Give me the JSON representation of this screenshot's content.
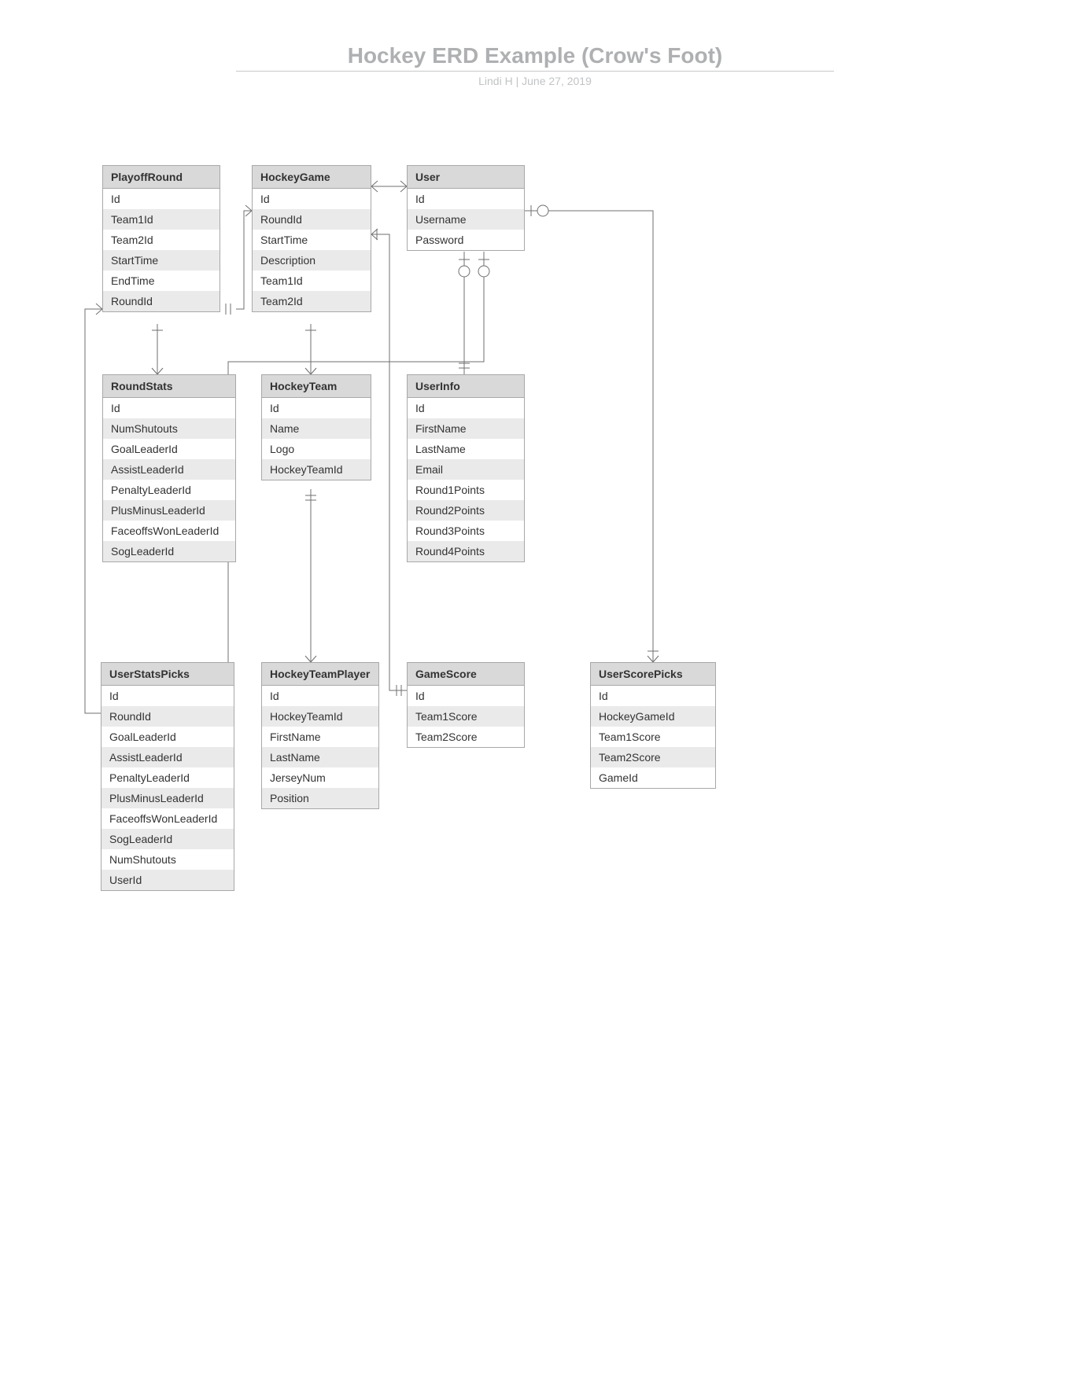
{
  "header": {
    "title": "Hockey ERD Example (Crow's Foot)",
    "subtitle": "Lindi H  |  June 27, 2019"
  },
  "entities": {
    "playoff_round": {
      "name": "PlayoffRound",
      "fields": [
        "Id",
        "Team1Id",
        "Team2Id",
        "StartTime",
        "EndTime",
        "RoundId"
      ]
    },
    "hockey_game": {
      "name": "HockeyGame",
      "fields": [
        "Id",
        "RoundId",
        "StartTime",
        "Description",
        "Team1Id",
        "Team2Id"
      ]
    },
    "user": {
      "name": "User",
      "fields": [
        "Id",
        "Username",
        "Password"
      ]
    },
    "round_stats": {
      "name": "RoundStats",
      "fields": [
        "Id",
        "NumShutouts",
        "GoalLeaderId",
        "AssistLeaderId",
        "PenaltyLeaderId",
        "PlusMinusLeaderId",
        "FaceoffsWonLeaderId",
        "SogLeaderId"
      ]
    },
    "hockey_team": {
      "name": "HockeyTeam",
      "fields": [
        "Id",
        "Name",
        "Logo",
        "HockeyTeamId"
      ]
    },
    "user_info": {
      "name": "UserInfo",
      "fields": [
        "Id",
        "FirstName",
        "LastName",
        "Email",
        "Round1Points",
        "Round2Points",
        "Round3Points",
        "Round4Points"
      ]
    },
    "user_stats_picks": {
      "name": "UserStatsPicks",
      "fields": [
        "Id",
        "RoundId",
        "GoalLeaderId",
        "AssistLeaderId",
        "PenaltyLeaderId",
        "PlusMinusLeaderId",
        "FaceoffsWonLeaderId",
        "SogLeaderId",
        "NumShutouts",
        "UserId"
      ]
    },
    "hockey_team_player": {
      "name": "HockeyTeamPlayer",
      "fields": [
        "Id",
        "HockeyTeamId",
        "FirstName",
        "LastName",
        "JerseyNum",
        "Position"
      ]
    },
    "game_score": {
      "name": "GameScore",
      "fields": [
        "Id",
        "Team1Score",
        "Team2Score"
      ]
    },
    "user_score_picks": {
      "name": "UserScorePicks",
      "fields": [
        "Id",
        "HockeyGameId",
        "Team1Score",
        "Team2Score",
        "GameId"
      ]
    }
  },
  "chart_data": {
    "type": "erd",
    "notation": "crows-foot",
    "relationships": [
      {
        "from": "PlayoffRound",
        "to": "HockeyGame",
        "from_card": "one-mandatory",
        "to_card": "many"
      },
      {
        "from": "PlayoffRound",
        "to": "RoundStats",
        "from_card": "one",
        "to_card": "many"
      },
      {
        "from": "PlayoffRound",
        "to": "UserStatsPicks",
        "from_card": "one",
        "to_card": "many",
        "via": "RoundId"
      },
      {
        "from": "HockeyGame",
        "to": "HockeyTeam",
        "from_card": "one",
        "to_card": "many"
      },
      {
        "from": "HockeyGame",
        "to": "User",
        "from_card": "many",
        "to_card": "many"
      },
      {
        "from": "HockeyGame",
        "to": "GameScore",
        "from_card": "one",
        "to_card": "one-mandatory"
      },
      {
        "from": "HockeyTeam",
        "to": "HockeyTeamPlayer",
        "from_card": "one-mandatory",
        "to_card": "many"
      },
      {
        "from": "User",
        "to": "UserInfo",
        "from_card": "one-optional",
        "to_card": "one-mandatory"
      },
      {
        "from": "User",
        "to": "UserStatsPicks",
        "from_card": "one-optional",
        "to_card": "many"
      },
      {
        "from": "User",
        "to": "UserScorePicks",
        "from_card": "one-optional",
        "to_card": "many"
      }
    ]
  }
}
